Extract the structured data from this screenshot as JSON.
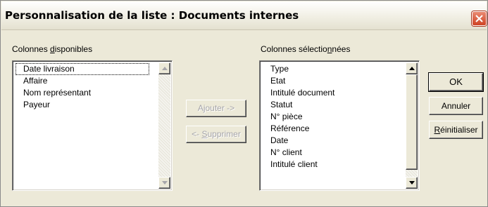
{
  "dialog": {
    "title": "Personnalisation de la liste : Documents internes"
  },
  "available": {
    "label_pre": "Colonnes ",
    "label_key": "d",
    "label_post": "isponibles",
    "items": [
      "Date livraison",
      "Affaire",
      "Nom représentant",
      "Payeur"
    ]
  },
  "selected": {
    "label_pre": "Colonnes sélectio",
    "label_key": "n",
    "label_post": "nées",
    "items": [
      "Type",
      "Etat",
      "Intitulé document",
      "Statut",
      "N° pièce",
      "Référence",
      "Date",
      "N° client",
      "Intitulé client"
    ]
  },
  "buttons": {
    "add": "Ajouter ->",
    "remove_pre": "<- ",
    "remove_key": "S",
    "remove_post": "upprimer",
    "ok": "OK",
    "cancel": "Annuler",
    "reset_key": "R",
    "reset_post": "éinitialiser"
  },
  "icons": {
    "close": "close-icon",
    "scroll_up": "arrow-up-icon",
    "scroll_down": "arrow-down-icon"
  },
  "colors": {
    "dialog_bg": "#ece9d8",
    "close_button": "#cf4324",
    "disabled_text": "#a7a6aa"
  }
}
